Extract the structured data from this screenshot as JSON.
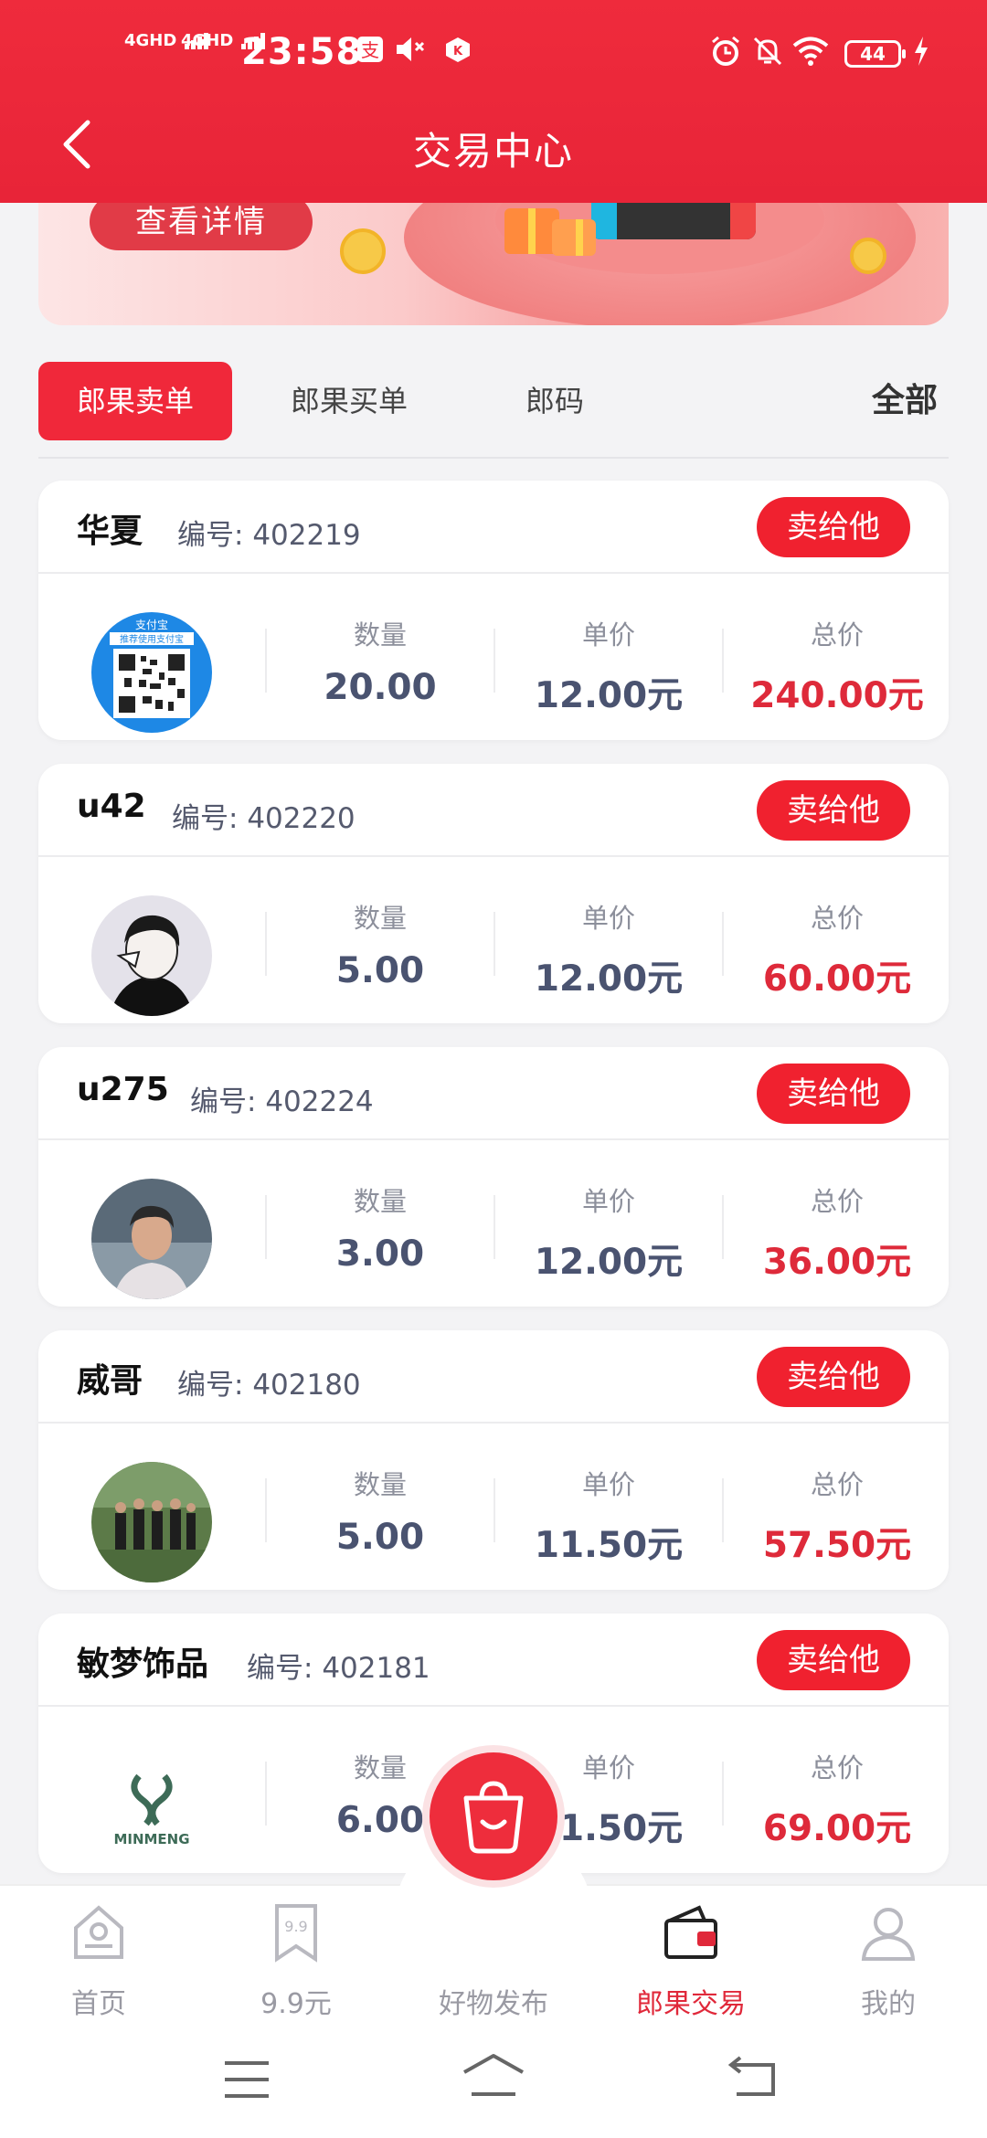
{
  "status_bar": {
    "time": "23:58",
    "net1": "4GHD",
    "net2": "4GHD",
    "battery": "44"
  },
  "header": {
    "title": "交易中心"
  },
  "banner": {
    "detail_button": "查看详情"
  },
  "tabs": [
    {
      "label": "郎果卖单",
      "active": true
    },
    {
      "label": "郎果买单",
      "active": false
    },
    {
      "label": "郎码",
      "active": false
    }
  ],
  "filter_all": "全部",
  "labels": {
    "id_prefix": "编号:",
    "sell_button": "卖给他",
    "qty": "数量",
    "unit_price": "单价",
    "total": "总价"
  },
  "orders": [
    {
      "name": "华夏",
      "id": "402219",
      "qty": "20.00",
      "price": "12.00元",
      "total": "240.00元"
    },
    {
      "name": "u42",
      "id": "402220",
      "qty": "5.00",
      "price": "12.00元",
      "total": "60.00元"
    },
    {
      "name": "u275",
      "id": "402224",
      "qty": "3.00",
      "price": "12.00元",
      "total": "36.00元"
    },
    {
      "name": "威哥",
      "id": "402180",
      "qty": "5.00",
      "price": "11.50元",
      "total": "57.50元"
    },
    {
      "name": "敏梦饰品",
      "id": "402181",
      "qty": "6.00",
      "price": "11.50元",
      "total": "69.00元"
    }
  ],
  "avatar_texts": {
    "alipay": "支付宝",
    "alipay_sub": "推荐使用支付宝",
    "minmeng": "MINMENG"
  },
  "bottom_nav": [
    {
      "label": "首页",
      "icon": "home-icon",
      "active": false
    },
    {
      "label": "9.9元",
      "icon": "bookmark-icon",
      "active": false
    },
    {
      "label": "好物发布",
      "icon": "bag-icon",
      "active": false
    },
    {
      "label": "郎果交易",
      "icon": "wallet-icon",
      "active": true
    },
    {
      "label": "我的",
      "icon": "user-icon",
      "active": false
    }
  ],
  "colors": {
    "brand": "#ef2b3c",
    "value_text": "#4a5370",
    "total_text": "#de2a3a"
  }
}
